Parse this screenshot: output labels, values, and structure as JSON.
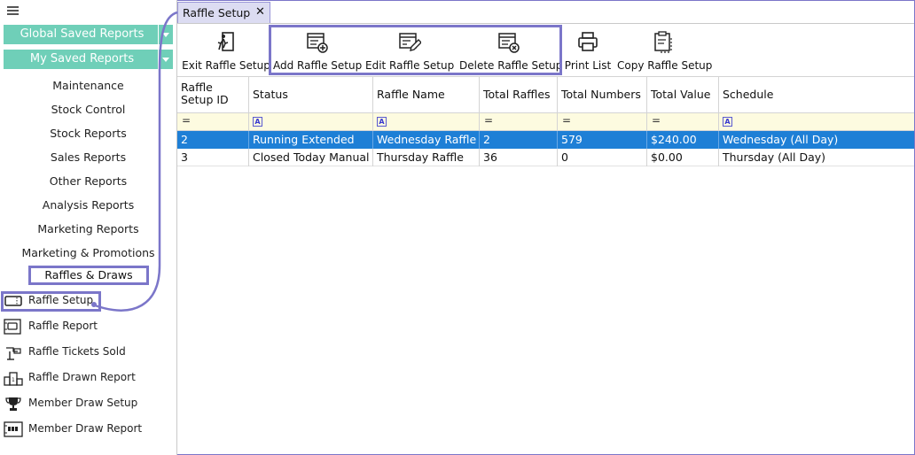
{
  "sidebar": {
    "saved_reports": [
      {
        "label": "Global Saved Reports"
      },
      {
        "label": "My Saved Reports"
      }
    ],
    "categories": [
      {
        "label": "Maintenance"
      },
      {
        "label": "Stock Control"
      },
      {
        "label": "Stock Reports"
      },
      {
        "label": "Sales Reports"
      },
      {
        "label": "Other Reports"
      },
      {
        "label": "Analysis Reports"
      },
      {
        "label": "Marketing Reports"
      },
      {
        "label": "Marketing & Promotions"
      },
      {
        "label": "Raffles & Draws"
      }
    ],
    "sub_items": [
      {
        "label": "Raffle Setup",
        "icon": "raffle-ticket-icon"
      },
      {
        "label": "Raffle Report",
        "icon": "raffle-report-icon"
      },
      {
        "label": "Raffle Tickets Sold",
        "icon": "tickets-sold-icon"
      },
      {
        "label": "Raffle Drawn Report",
        "icon": "drawn-report-icon"
      },
      {
        "label": "Member Draw Setup",
        "icon": "trophy-icon"
      },
      {
        "label": "Member Draw Report",
        "icon": "member-draw-report-icon"
      }
    ]
  },
  "tab": {
    "title": "Raffle Setup",
    "close": "✕"
  },
  "toolbar": {
    "buttons": [
      {
        "label": "Exit Raffle Setup",
        "icon": "exit-icon"
      },
      {
        "label": "Add Raffle Setup",
        "icon": "add-list-icon"
      },
      {
        "label": "Edit Raffle Setup",
        "icon": "edit-list-icon"
      },
      {
        "label": "Delete Raffle Setup",
        "icon": "delete-list-icon"
      },
      {
        "label": "Print List",
        "icon": "printer-icon"
      },
      {
        "label": "Copy Raffle Setup",
        "icon": "clipboard-copy-icon"
      }
    ]
  },
  "grid": {
    "columns": [
      {
        "label": "Raffle Setup ID",
        "filter": "="
      },
      {
        "label": "Status",
        "filter": "A"
      },
      {
        "label": "Raffle Name",
        "filter": "A"
      },
      {
        "label": "Total Raffles",
        "filter": "="
      },
      {
        "label": "Total Numbers",
        "filter": "="
      },
      {
        "label": "Total Value",
        "filter": "="
      },
      {
        "label": "Schedule",
        "filter": "A"
      }
    ],
    "rows": [
      [
        "2",
        "Running Extended",
        "Wednesday Raffle",
        "2",
        "579",
        "$240.00",
        "Wednesday (All Day)"
      ],
      [
        "3",
        "Closed Today Manual",
        "Thursday Raffle",
        "36",
        "0",
        "$0.00",
        "Thursday (All Day)"
      ]
    ],
    "selected_row": 0
  },
  "colors": {
    "accent_green": "#6fcfb8",
    "highlight_purple": "#7b76c9",
    "selection_blue": "#1e7fd6",
    "filter_row": "#fdfbe0"
  }
}
